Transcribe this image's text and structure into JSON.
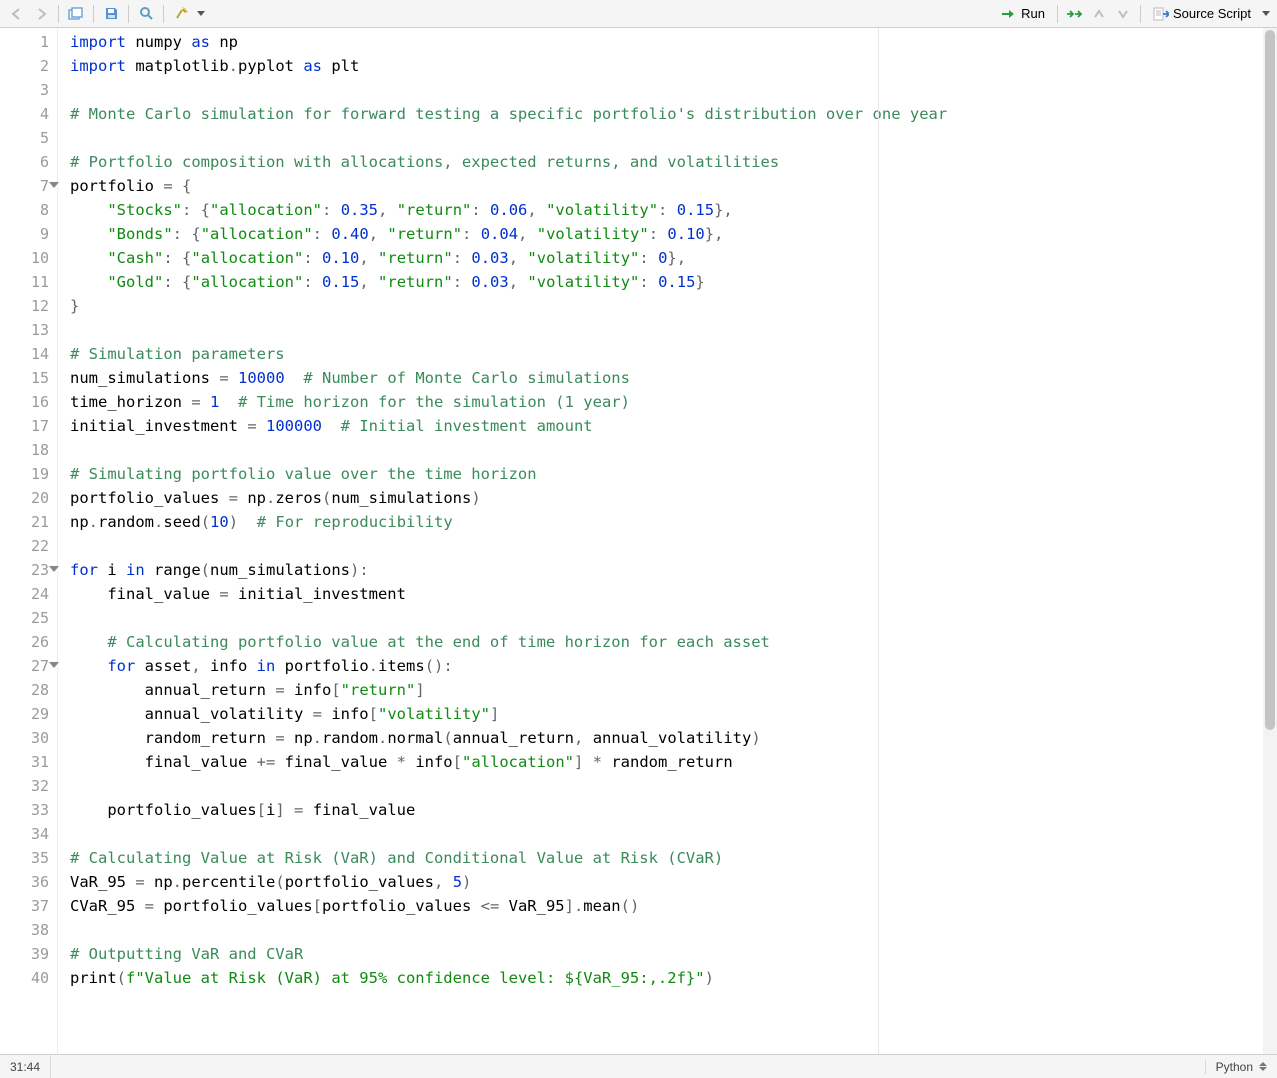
{
  "toolbar": {
    "run_label": "Run",
    "source_label": "Source Script"
  },
  "status": {
    "cursor": "31:44",
    "language": "Python"
  },
  "gutter": {
    "lines": [
      "1",
      "2",
      "3",
      "4",
      "5",
      "6",
      "7",
      "8",
      "9",
      "10",
      "11",
      "12",
      "13",
      "14",
      "15",
      "16",
      "17",
      "18",
      "19",
      "20",
      "21",
      "22",
      "23",
      "24",
      "25",
      "26",
      "27",
      "28",
      "29",
      "30",
      "31",
      "32",
      "33",
      "34",
      "35",
      "36",
      "37",
      "38",
      "39",
      "40"
    ],
    "fold_lines": [
      7,
      23,
      27
    ]
  },
  "code": [
    [
      [
        "kw",
        "import"
      ],
      [
        "id",
        " numpy "
      ],
      [
        "kw",
        "as"
      ],
      [
        "id",
        " np"
      ]
    ],
    [
      [
        "kw",
        "import"
      ],
      [
        "id",
        " matplotlib"
      ],
      [
        "op",
        "."
      ],
      [
        "id",
        "pyplot "
      ],
      [
        "kw",
        "as"
      ],
      [
        "id",
        " plt"
      ]
    ],
    [
      [
        "id",
        ""
      ]
    ],
    [
      [
        "cmt",
        "# Monte Carlo simulation for forward testing a specific portfolio's distribution over one year"
      ]
    ],
    [
      [
        "id",
        ""
      ]
    ],
    [
      [
        "cmt",
        "# Portfolio composition with allocations, expected returns, and volatilities"
      ]
    ],
    [
      [
        "id",
        "portfolio "
      ],
      [
        "op",
        "="
      ],
      [
        "id",
        " "
      ],
      [
        "op",
        "{"
      ]
    ],
    [
      [
        "id",
        "    "
      ],
      [
        "str",
        "\"Stocks\""
      ],
      [
        "op",
        ":"
      ],
      [
        "id",
        " "
      ],
      [
        "op",
        "{"
      ],
      [
        "str",
        "\"allocation\""
      ],
      [
        "op",
        ":"
      ],
      [
        "id",
        " "
      ],
      [
        "num",
        "0.35"
      ],
      [
        "op",
        ","
      ],
      [
        "id",
        " "
      ],
      [
        "str",
        "\"return\""
      ],
      [
        "op",
        ":"
      ],
      [
        "id",
        " "
      ],
      [
        "num",
        "0.06"
      ],
      [
        "op",
        ","
      ],
      [
        "id",
        " "
      ],
      [
        "str",
        "\"volatility\""
      ],
      [
        "op",
        ":"
      ],
      [
        "id",
        " "
      ],
      [
        "num",
        "0.15"
      ],
      [
        "op",
        "},"
      ]
    ],
    [
      [
        "id",
        "    "
      ],
      [
        "str",
        "\"Bonds\""
      ],
      [
        "op",
        ":"
      ],
      [
        "id",
        " "
      ],
      [
        "op",
        "{"
      ],
      [
        "str",
        "\"allocation\""
      ],
      [
        "op",
        ":"
      ],
      [
        "id",
        " "
      ],
      [
        "num",
        "0.40"
      ],
      [
        "op",
        ","
      ],
      [
        "id",
        " "
      ],
      [
        "str",
        "\"return\""
      ],
      [
        "op",
        ":"
      ],
      [
        "id",
        " "
      ],
      [
        "num",
        "0.04"
      ],
      [
        "op",
        ","
      ],
      [
        "id",
        " "
      ],
      [
        "str",
        "\"volatility\""
      ],
      [
        "op",
        ":"
      ],
      [
        "id",
        " "
      ],
      [
        "num",
        "0.10"
      ],
      [
        "op",
        "},"
      ]
    ],
    [
      [
        "id",
        "    "
      ],
      [
        "str",
        "\"Cash\""
      ],
      [
        "op",
        ":"
      ],
      [
        "id",
        " "
      ],
      [
        "op",
        "{"
      ],
      [
        "str",
        "\"allocation\""
      ],
      [
        "op",
        ":"
      ],
      [
        "id",
        " "
      ],
      [
        "num",
        "0.10"
      ],
      [
        "op",
        ","
      ],
      [
        "id",
        " "
      ],
      [
        "str",
        "\"return\""
      ],
      [
        "op",
        ":"
      ],
      [
        "id",
        " "
      ],
      [
        "num",
        "0.03"
      ],
      [
        "op",
        ","
      ],
      [
        "id",
        " "
      ],
      [
        "str",
        "\"volatility\""
      ],
      [
        "op",
        ":"
      ],
      [
        "id",
        " "
      ],
      [
        "num",
        "0"
      ],
      [
        "op",
        "},"
      ]
    ],
    [
      [
        "id",
        "    "
      ],
      [
        "str",
        "\"Gold\""
      ],
      [
        "op",
        ":"
      ],
      [
        "id",
        " "
      ],
      [
        "op",
        "{"
      ],
      [
        "str",
        "\"allocation\""
      ],
      [
        "op",
        ":"
      ],
      [
        "id",
        " "
      ],
      [
        "num",
        "0.15"
      ],
      [
        "op",
        ","
      ],
      [
        "id",
        " "
      ],
      [
        "str",
        "\"return\""
      ],
      [
        "op",
        ":"
      ],
      [
        "id",
        " "
      ],
      [
        "num",
        "0.03"
      ],
      [
        "op",
        ","
      ],
      [
        "id",
        " "
      ],
      [
        "str",
        "\"volatility\""
      ],
      [
        "op",
        ":"
      ],
      [
        "id",
        " "
      ],
      [
        "num",
        "0.15"
      ],
      [
        "op",
        "}"
      ]
    ],
    [
      [
        "op",
        "}"
      ]
    ],
    [
      [
        "id",
        ""
      ]
    ],
    [
      [
        "cmt",
        "# Simulation parameters"
      ]
    ],
    [
      [
        "id",
        "num_simulations "
      ],
      [
        "op",
        "="
      ],
      [
        "id",
        " "
      ],
      [
        "num",
        "10000"
      ],
      [
        "id",
        "  "
      ],
      [
        "cmt",
        "# Number of Monte Carlo simulations"
      ]
    ],
    [
      [
        "id",
        "time_horizon "
      ],
      [
        "op",
        "="
      ],
      [
        "id",
        " "
      ],
      [
        "num",
        "1"
      ],
      [
        "id",
        "  "
      ],
      [
        "cmt",
        "# Time horizon for the simulation (1 year)"
      ]
    ],
    [
      [
        "id",
        "initial_investment "
      ],
      [
        "op",
        "="
      ],
      [
        "id",
        " "
      ],
      [
        "num",
        "100000"
      ],
      [
        "id",
        "  "
      ],
      [
        "cmt",
        "# Initial investment amount"
      ]
    ],
    [
      [
        "id",
        ""
      ]
    ],
    [
      [
        "cmt",
        "# Simulating portfolio value over the time horizon"
      ]
    ],
    [
      [
        "id",
        "portfolio_values "
      ],
      [
        "op",
        "="
      ],
      [
        "id",
        " np"
      ],
      [
        "op",
        "."
      ],
      [
        "id",
        "zeros"
      ],
      [
        "op",
        "("
      ],
      [
        "id",
        "num_simulations"
      ],
      [
        "op",
        ")"
      ]
    ],
    [
      [
        "id",
        "np"
      ],
      [
        "op",
        "."
      ],
      [
        "id",
        "random"
      ],
      [
        "op",
        "."
      ],
      [
        "id",
        "seed"
      ],
      [
        "op",
        "("
      ],
      [
        "num",
        "10"
      ],
      [
        "op",
        ")"
      ],
      [
        "id",
        "  "
      ],
      [
        "cmt",
        "# For reproducibility"
      ]
    ],
    [
      [
        "id",
        ""
      ]
    ],
    [
      [
        "kw",
        "for"
      ],
      [
        "id",
        " i "
      ],
      [
        "kw",
        "in"
      ],
      [
        "id",
        " range"
      ],
      [
        "op",
        "("
      ],
      [
        "id",
        "num_simulations"
      ],
      [
        "op",
        "):"
      ]
    ],
    [
      [
        "id",
        "    final_value "
      ],
      [
        "op",
        "="
      ],
      [
        "id",
        " initial_investment"
      ]
    ],
    [
      [
        "id",
        ""
      ]
    ],
    [
      [
        "id",
        "    "
      ],
      [
        "cmt",
        "# Calculating portfolio value at the end of time horizon for each asset"
      ]
    ],
    [
      [
        "id",
        "    "
      ],
      [
        "kw",
        "for"
      ],
      [
        "id",
        " asset"
      ],
      [
        "op",
        ","
      ],
      [
        "id",
        " info "
      ],
      [
        "kw",
        "in"
      ],
      [
        "id",
        " portfolio"
      ],
      [
        "op",
        "."
      ],
      [
        "id",
        "items"
      ],
      [
        "op",
        "():"
      ]
    ],
    [
      [
        "id",
        "        annual_return "
      ],
      [
        "op",
        "="
      ],
      [
        "id",
        " info"
      ],
      [
        "op",
        "["
      ],
      [
        "str",
        "\"return\""
      ],
      [
        "op",
        "]"
      ]
    ],
    [
      [
        "id",
        "        annual_volatility "
      ],
      [
        "op",
        "="
      ],
      [
        "id",
        " info"
      ],
      [
        "op",
        "["
      ],
      [
        "str",
        "\"volatility\""
      ],
      [
        "op",
        "]"
      ]
    ],
    [
      [
        "id",
        "        random_return "
      ],
      [
        "op",
        "="
      ],
      [
        "id",
        " np"
      ],
      [
        "op",
        "."
      ],
      [
        "id",
        "random"
      ],
      [
        "op",
        "."
      ],
      [
        "id",
        "normal"
      ],
      [
        "op",
        "("
      ],
      [
        "id",
        "annual_return"
      ],
      [
        "op",
        ","
      ],
      [
        "id",
        " annual_volatility"
      ],
      [
        "op",
        ")"
      ]
    ],
    [
      [
        "id",
        "        final_value "
      ],
      [
        "op",
        "+="
      ],
      [
        "id",
        " final_value "
      ],
      [
        "op",
        "*"
      ],
      [
        "id",
        " info"
      ],
      [
        "op",
        "["
      ],
      [
        "str",
        "\"allocation\""
      ],
      [
        "op",
        "]"
      ],
      [
        "id",
        " "
      ],
      [
        "op",
        "*"
      ],
      [
        "id",
        " random_return"
      ]
    ],
    [
      [
        "id",
        ""
      ]
    ],
    [
      [
        "id",
        "    portfolio_values"
      ],
      [
        "op",
        "["
      ],
      [
        "id",
        "i"
      ],
      [
        "op",
        "]"
      ],
      [
        "id",
        " "
      ],
      [
        "op",
        "="
      ],
      [
        "id",
        " final_value"
      ]
    ],
    [
      [
        "id",
        ""
      ]
    ],
    [
      [
        "cmt",
        "# Calculating Value at Risk (VaR) and Conditional Value at Risk (CVaR)"
      ]
    ],
    [
      [
        "id",
        "VaR_95 "
      ],
      [
        "op",
        "="
      ],
      [
        "id",
        " np"
      ],
      [
        "op",
        "."
      ],
      [
        "id",
        "percentile"
      ],
      [
        "op",
        "("
      ],
      [
        "id",
        "portfolio_values"
      ],
      [
        "op",
        ","
      ],
      [
        "id",
        " "
      ],
      [
        "num",
        "5"
      ],
      [
        "op",
        ")"
      ]
    ],
    [
      [
        "id",
        "CVaR_95 "
      ],
      [
        "op",
        "="
      ],
      [
        "id",
        " portfolio_values"
      ],
      [
        "op",
        "["
      ],
      [
        "id",
        "portfolio_values "
      ],
      [
        "op",
        "<="
      ],
      [
        "id",
        " VaR_95"
      ],
      [
        "op",
        "]."
      ],
      [
        "id",
        "mean"
      ],
      [
        "op",
        "()"
      ]
    ],
    [
      [
        "id",
        ""
      ]
    ],
    [
      [
        "cmt",
        "# Outputting VaR and CVaR"
      ]
    ],
    [
      [
        "id",
        "print"
      ],
      [
        "op",
        "("
      ],
      [
        "str",
        "f\"Value at Risk (VaR) at 95% confidence level: ${VaR_95:,.2f}\""
      ],
      [
        "op",
        ")"
      ]
    ]
  ]
}
